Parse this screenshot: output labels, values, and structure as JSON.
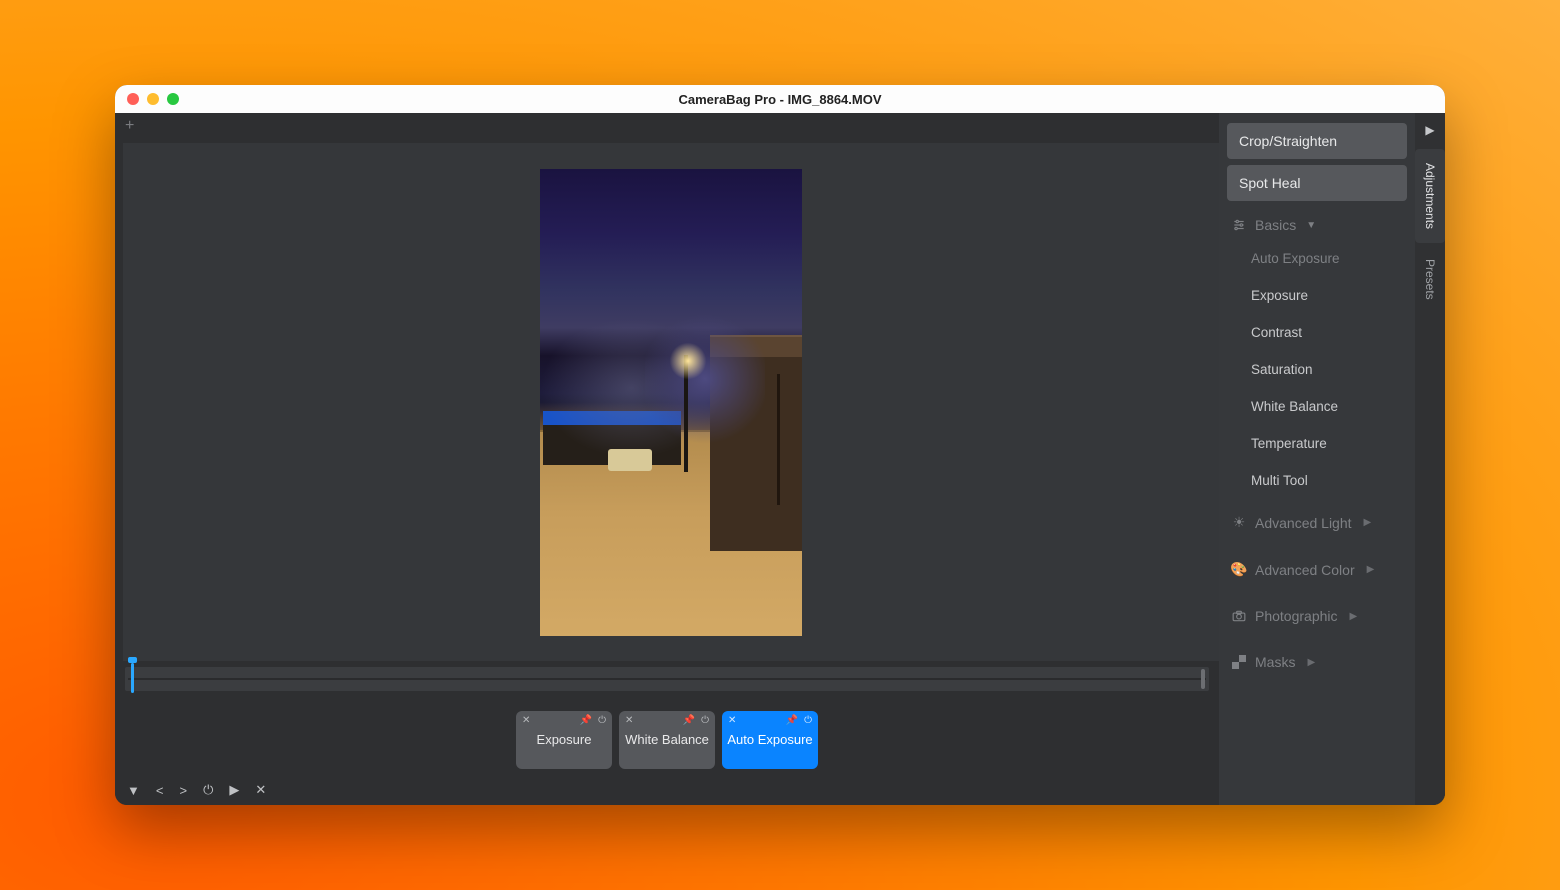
{
  "window": {
    "title": "CameraBag Pro - IMG_8864.MOV"
  },
  "chips": [
    {
      "label": "Exposure",
      "active": false
    },
    {
      "label": "White Balance",
      "active": false
    },
    {
      "label": "Auto Exposure",
      "active": true
    }
  ],
  "right_panel": {
    "tools": [
      {
        "label": "Crop/Straighten"
      },
      {
        "label": "Spot Heal"
      }
    ],
    "basics_header": "Basics",
    "basics_items": [
      {
        "label": "Auto Exposure",
        "muted": true
      },
      {
        "label": "Exposure",
        "muted": false
      },
      {
        "label": "Contrast",
        "muted": false
      },
      {
        "label": "Saturation",
        "muted": false
      },
      {
        "label": "White Balance",
        "muted": false
      },
      {
        "label": "Temperature",
        "muted": false
      },
      {
        "label": "Multi Tool",
        "muted": false
      }
    ],
    "sections": [
      {
        "label": "Advanced Light",
        "icon": "sun"
      },
      {
        "label": "Advanced Color",
        "icon": "palette"
      },
      {
        "label": "Photographic",
        "icon": "camera"
      },
      {
        "label": "Masks",
        "icon": "checker"
      }
    ]
  },
  "side_tabs": {
    "adjustments": "Adjustments",
    "presets": "Presets"
  }
}
